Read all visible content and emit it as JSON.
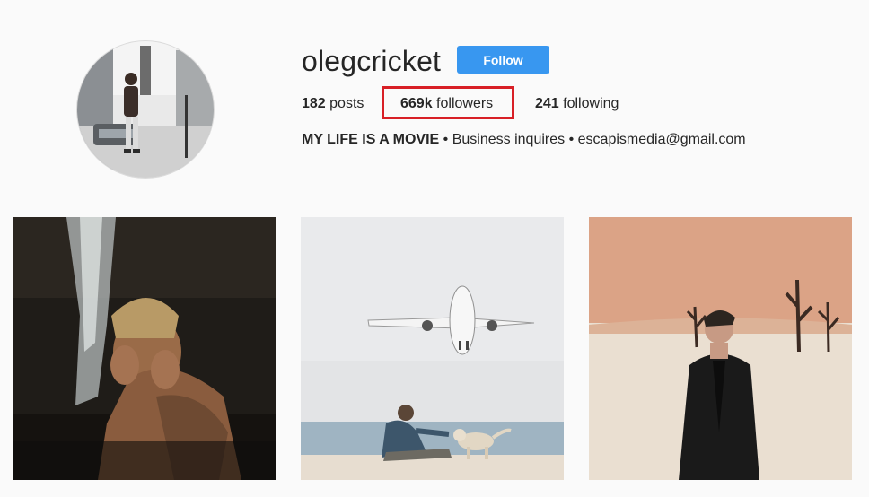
{
  "profile": {
    "username": "olegcricket",
    "follow_label": "Follow",
    "stats": {
      "posts_count": "182",
      "posts_label": "posts",
      "followers_count": "669k",
      "followers_label": "followers",
      "following_count": "241",
      "following_label": "following"
    },
    "bio": {
      "headline": "MY LIFE IS A MOVIE",
      "separator_1": "•",
      "business_text": "Business inquires",
      "separator_2": "•",
      "email": "escapismedia@gmail.com"
    },
    "highlight_color": "#d81f26",
    "follow_button_color": "#3897f0"
  },
  "posts": [
    {
      "subject": "man washing face under waterfall"
    },
    {
      "subject": "man with dog on beach under airplane"
    },
    {
      "subject": "man in black leather jacket in desert"
    }
  ]
}
